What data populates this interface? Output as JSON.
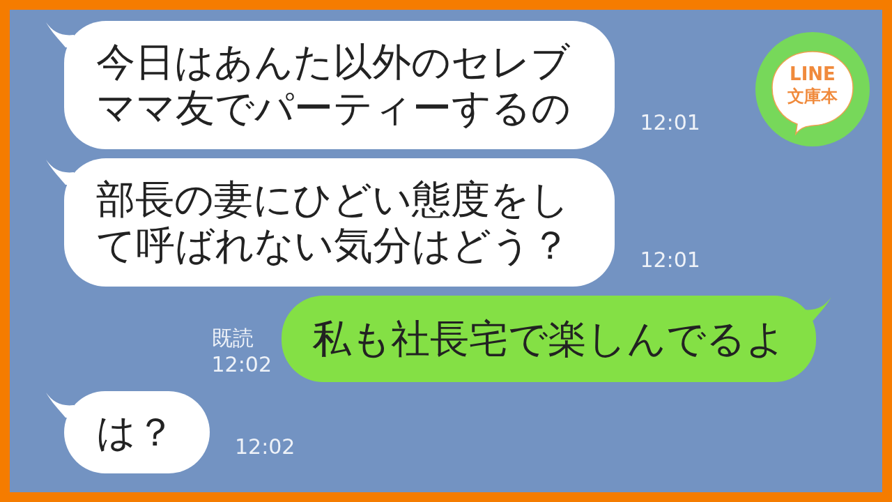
{
  "messages": [
    {
      "kind": "received",
      "text": "今日はあんた以外のセレブママ友でパーティーするの",
      "time": "12:01"
    },
    {
      "kind": "received",
      "text": "部長の妻にひどい態度をして呼ばれない気分はどう？",
      "time": "12:01"
    },
    {
      "kind": "sent",
      "read_label": "既読",
      "text": "私も社長宅で楽しんでるよ",
      "time": "12:02"
    },
    {
      "kind": "received",
      "text": "は？",
      "time": "12:02"
    }
  ],
  "logo": {
    "lines": [
      "LINE",
      "文庫本"
    ]
  }
}
